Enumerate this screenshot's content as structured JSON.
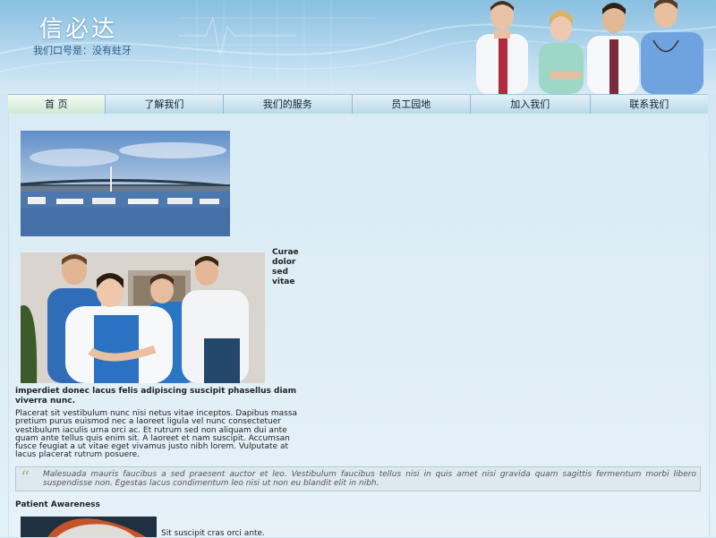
{
  "header": {
    "site_title": "信必达",
    "slogan": "我们口号是：没有蛀牙"
  },
  "nav": {
    "items": [
      {
        "label": "首 页",
        "active": true
      },
      {
        "label": "了解我们",
        "active": false
      },
      {
        "label": "我们的服务",
        "active": false
      },
      {
        "label": "员工园地",
        "active": false
      },
      {
        "label": "加入我们",
        "active": false
      },
      {
        "label": "联系我们",
        "active": false
      }
    ]
  },
  "main": {
    "side_words": "Curae dolor sed vitae",
    "bold_line": "imperdiet donec lacus felis adipiscing suscipit phasellus diam viverra nunc.",
    "paragraph": "Placerat sit vestibulum nunc nisi netus vitae inceptos. Dapibus massa pretium purus euismod nec a laoreet ligula vel nunc consectetuer vestibulum iaculis urna orci ac. Et rutrum sed non aliquam dui ante quam ante tellus quis enim sit. A laoreet et nam suscipit. Accumsan fusce feugiat a ut vitae eget vivamus justo nibh lorem. Vulputate at lacus placerat rutrum posuere.",
    "quote_mark": "“",
    "quote": "Malesuada mauris faucibus a sed praesent auctor et leo. Vestibulum faucibus tellus nisi in quis amet nisi gravida quam sagittis fermentum morbi libero suspendisse non. Egestas lacus condimentum leo nisi ut non eu blandit elit in nibh.",
    "section_title": "Patient Awareness",
    "bottom_text": "Sit suscipit cras orci ante."
  },
  "colors": {
    "header_top": "#89bfe0",
    "nav_border": "#8fbcd6",
    "quote_mark": "#8fbe7b"
  }
}
